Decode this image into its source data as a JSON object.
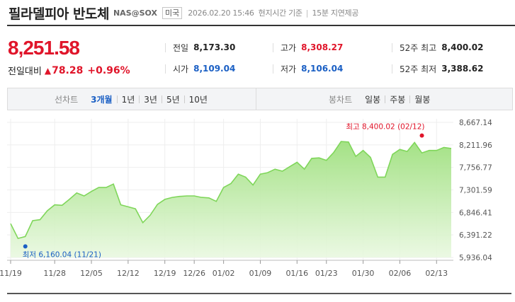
{
  "header": {
    "stock_name": "필라델피아 반도체",
    "ticker": "NAS@SOX",
    "market": "미국",
    "datetime": "2026.02.20 15:46",
    "time_basis": "현지시간 기준",
    "separator": "|",
    "delay_note": "15분 지연제공"
  },
  "price": {
    "current": "8,251.58",
    "change_label": "전일대비",
    "change_icon": "▲",
    "change": "78.28",
    "change_pct": "+0.96%"
  },
  "stats": [
    {
      "label": "전일",
      "value": "8,173.30",
      "color": "black"
    },
    {
      "label": "시가",
      "value": "8,109.04",
      "color": "blue"
    },
    {
      "label": "고가",
      "value": "8,308.27",
      "color": "red"
    },
    {
      "label": "저가",
      "value": "8,106.04",
      "color": "blue"
    },
    {
      "label": "52주 최고",
      "value": "8,400.02",
      "color": "black"
    },
    {
      "label": "52주 최저",
      "value": "3,388.62",
      "color": "black"
    }
  ],
  "line_chart_tabs": {
    "label": "선차트",
    "items": [
      "3개월",
      "1년",
      "3년",
      "5년",
      "10년"
    ],
    "active": "3개월"
  },
  "candle_chart_tabs": {
    "label": "봉차트",
    "items": [
      "일봉",
      "주봉",
      "월봉"
    ]
  },
  "colors": {
    "up": "#e0152a",
    "down": "#1a5fc4",
    "area_fill": "#a6e58a",
    "line": "#7fd65a"
  },
  "chart_data": {
    "type": "area",
    "title": "",
    "xlabel": "",
    "ylabel": "",
    "ylim": [
      5936.04,
      8667.14
    ],
    "y_ticks": [
      "8,667.14",
      "8,211.96",
      "7,756.77",
      "7,301.59",
      "6,846.41",
      "6,391.22",
      "5,936.04"
    ],
    "x_ticks": [
      "11/19",
      "11/28",
      "12/05",
      "12/12",
      "12/19",
      "12/26",
      "01/02",
      "01/09",
      "01/16",
      "01/23",
      "01/30",
      "02/06",
      "02/13"
    ],
    "x_tick_index": [
      0,
      6,
      11,
      16,
      21,
      25,
      29,
      34,
      39,
      43,
      48,
      53,
      58
    ],
    "annotations": {
      "high_label": "최고 8,400.02 (02/12)",
      "low_label": "최저 6,160.04 (11/21)",
      "high_value": 8400.02,
      "low_value": 6160.04,
      "high_index": 56,
      "low_index": 2
    },
    "series": [
      {
        "values": [
          6620,
          6320,
          6360,
          6680,
          6700,
          6880,
          7000,
          6990,
          7110,
          7240,
          7180,
          7270,
          7350,
          7350,
          7420,
          7000,
          6960,
          6920,
          6640,
          6790,
          7010,
          7110,
          7150,
          7170,
          7180,
          7180,
          7150,
          7140,
          7070,
          7350,
          7430,
          7620,
          7560,
          7400,
          7620,
          7650,
          7720,
          7680,
          7770,
          7860,
          7720,
          7940,
          7950,
          7900,
          8060,
          8280,
          8270,
          7980,
          8100,
          7960,
          7560,
          7560,
          8020,
          8120,
          8080,
          8260,
          8050,
          8100,
          8100,
          8160,
          8140
        ]
      }
    ]
  }
}
